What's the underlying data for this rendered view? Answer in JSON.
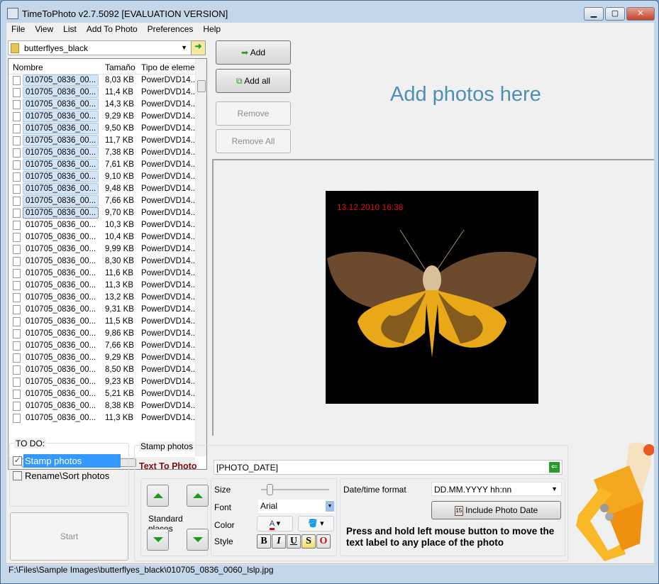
{
  "window": {
    "title": "TimeToPhoto v2.7.5092 [EVALUATION VERSION]",
    "minimize": "▁",
    "maximize": "▢",
    "close": "✕"
  },
  "menu": [
    "File",
    "View",
    "List",
    "Add To Photo",
    "Preferences",
    "Help"
  ],
  "folder": {
    "value": "butterflyes_black"
  },
  "file_list": {
    "columns": [
      "Nombre",
      "Tamaño",
      "Tipo de eleme..."
    ],
    "rows": [
      {
        "name": "010705_0836_00...",
        "size": "8,03 KB",
        "type": "PowerDVD14...",
        "selected": true
      },
      {
        "name": "010705_0836_00...",
        "size": "11,4 KB",
        "type": "PowerDVD14...",
        "selected": true
      },
      {
        "name": "010705_0836_00...",
        "size": "14,3 KB",
        "type": "PowerDVD14...",
        "selected": true
      },
      {
        "name": "010705_0836_00...",
        "size": "9,29 KB",
        "type": "PowerDVD14...",
        "selected": true
      },
      {
        "name": "010705_0836_00...",
        "size": "9,50 KB",
        "type": "PowerDVD14...",
        "selected": true
      },
      {
        "name": "010705_0836_00...",
        "size": "11,7 KB",
        "type": "PowerDVD14...",
        "selected": true
      },
      {
        "name": "010705_0836_00...",
        "size": "7,38 KB",
        "type": "PowerDVD14...",
        "selected": true
      },
      {
        "name": "010705_0836_00...",
        "size": "7,61 KB",
        "type": "PowerDVD14...",
        "selected": true
      },
      {
        "name": "010705_0836_00...",
        "size": "9,10 KB",
        "type": "PowerDVD14...",
        "selected": true
      },
      {
        "name": "010705_0836_00...",
        "size": "9,48 KB",
        "type": "PowerDVD14...",
        "selected": true
      },
      {
        "name": "010705_0836_00...",
        "size": "7,66 KB",
        "type": "PowerDVD14...",
        "selected": true
      },
      {
        "name": "010705_0836_00...",
        "size": "9,70 KB",
        "type": "PowerDVD14...",
        "selected": true,
        "focused": true
      },
      {
        "name": "010705_0836_00...",
        "size": "10,3 KB",
        "type": "PowerDVD14..."
      },
      {
        "name": "010705_0836_00...",
        "size": "10,4 KB",
        "type": "PowerDVD14..."
      },
      {
        "name": "010705_0836_00...",
        "size": "9,99 KB",
        "type": "PowerDVD14..."
      },
      {
        "name": "010705_0836_00...",
        "size": "8,30 KB",
        "type": "PowerDVD14..."
      },
      {
        "name": "010705_0836_00...",
        "size": "11,6 KB",
        "type": "PowerDVD14..."
      },
      {
        "name": "010705_0836_00...",
        "size": "11,3 KB",
        "type": "PowerDVD14..."
      },
      {
        "name": "010705_0836_00...",
        "size": "13,2 KB",
        "type": "PowerDVD14..."
      },
      {
        "name": "010705_0836_00...",
        "size": "9,31 KB",
        "type": "PowerDVD14..."
      },
      {
        "name": "010705_0836_00...",
        "size": "11,5 KB",
        "type": "PowerDVD14..."
      },
      {
        "name": "010705_0836_00...",
        "size": "9,86 KB",
        "type": "PowerDVD14..."
      },
      {
        "name": "010705_0836_00...",
        "size": "7,66 KB",
        "type": "PowerDVD14..."
      },
      {
        "name": "010705_0836_00...",
        "size": "9,29 KB",
        "type": "PowerDVD14..."
      },
      {
        "name": "010705_0836_00...",
        "size": "8,50 KB",
        "type": "PowerDVD14..."
      },
      {
        "name": "010705_0836_00...",
        "size": "9,23 KB",
        "type": "PowerDVD14..."
      },
      {
        "name": "010705_0836_00...",
        "size": "5,21 KB",
        "type": "PowerDVD14..."
      },
      {
        "name": "010705_0836_00...",
        "size": "8,38 KB",
        "type": "PowerDVD14..."
      },
      {
        "name": "010705_0836_00...",
        "size": "11,3 KB",
        "type": "PowerDVD14..."
      }
    ]
  },
  "actions": {
    "add": "Add",
    "add_all": "Add all",
    "remove": "Remove",
    "remove_all": "Remove All"
  },
  "drop_hint": "Add photos here",
  "preview": {
    "stamp_text": "13.12.2010 16:38"
  },
  "todo": {
    "title": "TO DO:",
    "stamp": "Stamp photos",
    "stamp_checked": true,
    "rename": "Rename\\Sort photos",
    "rename_checked": false,
    "start": "Start"
  },
  "stamp": {
    "title": "Stamp photos",
    "text_label": "Text To Photo",
    "text_value": "[PHOTO_DATE]",
    "standard_places": "Standard places",
    "size_label": "Size",
    "font_label": "Font",
    "font_value": "Arial",
    "color_label": "Color",
    "style_label": "Style",
    "style_buttons": [
      "B",
      "I",
      "U",
      "S",
      "O"
    ],
    "datetime_label": "Date/time format",
    "datetime_value": "DD.MM.YYYY hh:nn",
    "include_date": "Include Photo Date",
    "hint": "Press and hold left mouse button to move the text label to any place of the photo"
  },
  "status": "F:\\Files\\Sample Images\\butterflyes_black\\010705_0836_0060_lslp.jpg",
  "colors": {
    "accent": "#4d8fb5",
    "text_label": "#7a1010",
    "stamp_text": "#e01010"
  }
}
